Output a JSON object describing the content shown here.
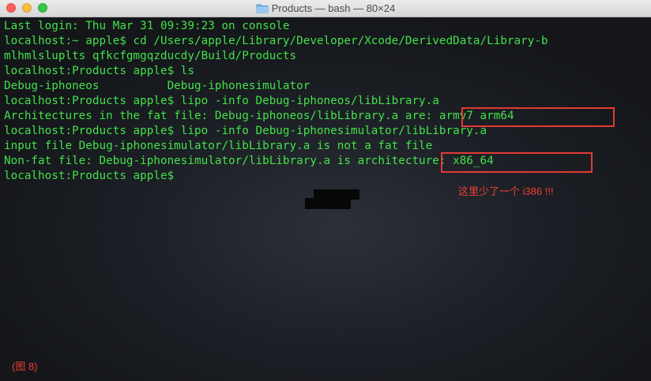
{
  "window": {
    "title": "Products — bash — 80×24",
    "folder_icon": "folder-icon"
  },
  "terminal": {
    "lines": [
      "Last login: Thu Mar 31 09:39:23 on console",
      "localhost:~ apple$ cd /Users/apple/Library/Developer/Xcode/DerivedData/Library-b",
      "mlhmlsluplts qfkcfgmgqzducdy/Build/Products",
      "localhost:Products apple$ ls",
      "Debug-iphoneos          Debug-iphonesimulator",
      "localhost:Products apple$ lipo -info Debug-iphoneos/libLibrary.a",
      "Architectures in the fat file: Debug-iphoneos/libLibrary.a are: armv7 arm64",
      "localhost:Products apple$ lipo -info Debug-iphonesimulator/libLibrary.a",
      "input file Debug-iphonesimulator/libLibrary.a is not a fat file",
      "Non-fat file: Debug-iphonesimulator/libLibrary.a is architecture: x86_64",
      "localhost:Products apple$"
    ]
  },
  "annotations": {
    "note": "这里少了一个 i386 !!!",
    "figure_label": "(图 8)"
  },
  "colors": {
    "terminal_text": "#43e14a",
    "highlight": "#e43a36",
    "note_text": "#ef3f33"
  }
}
